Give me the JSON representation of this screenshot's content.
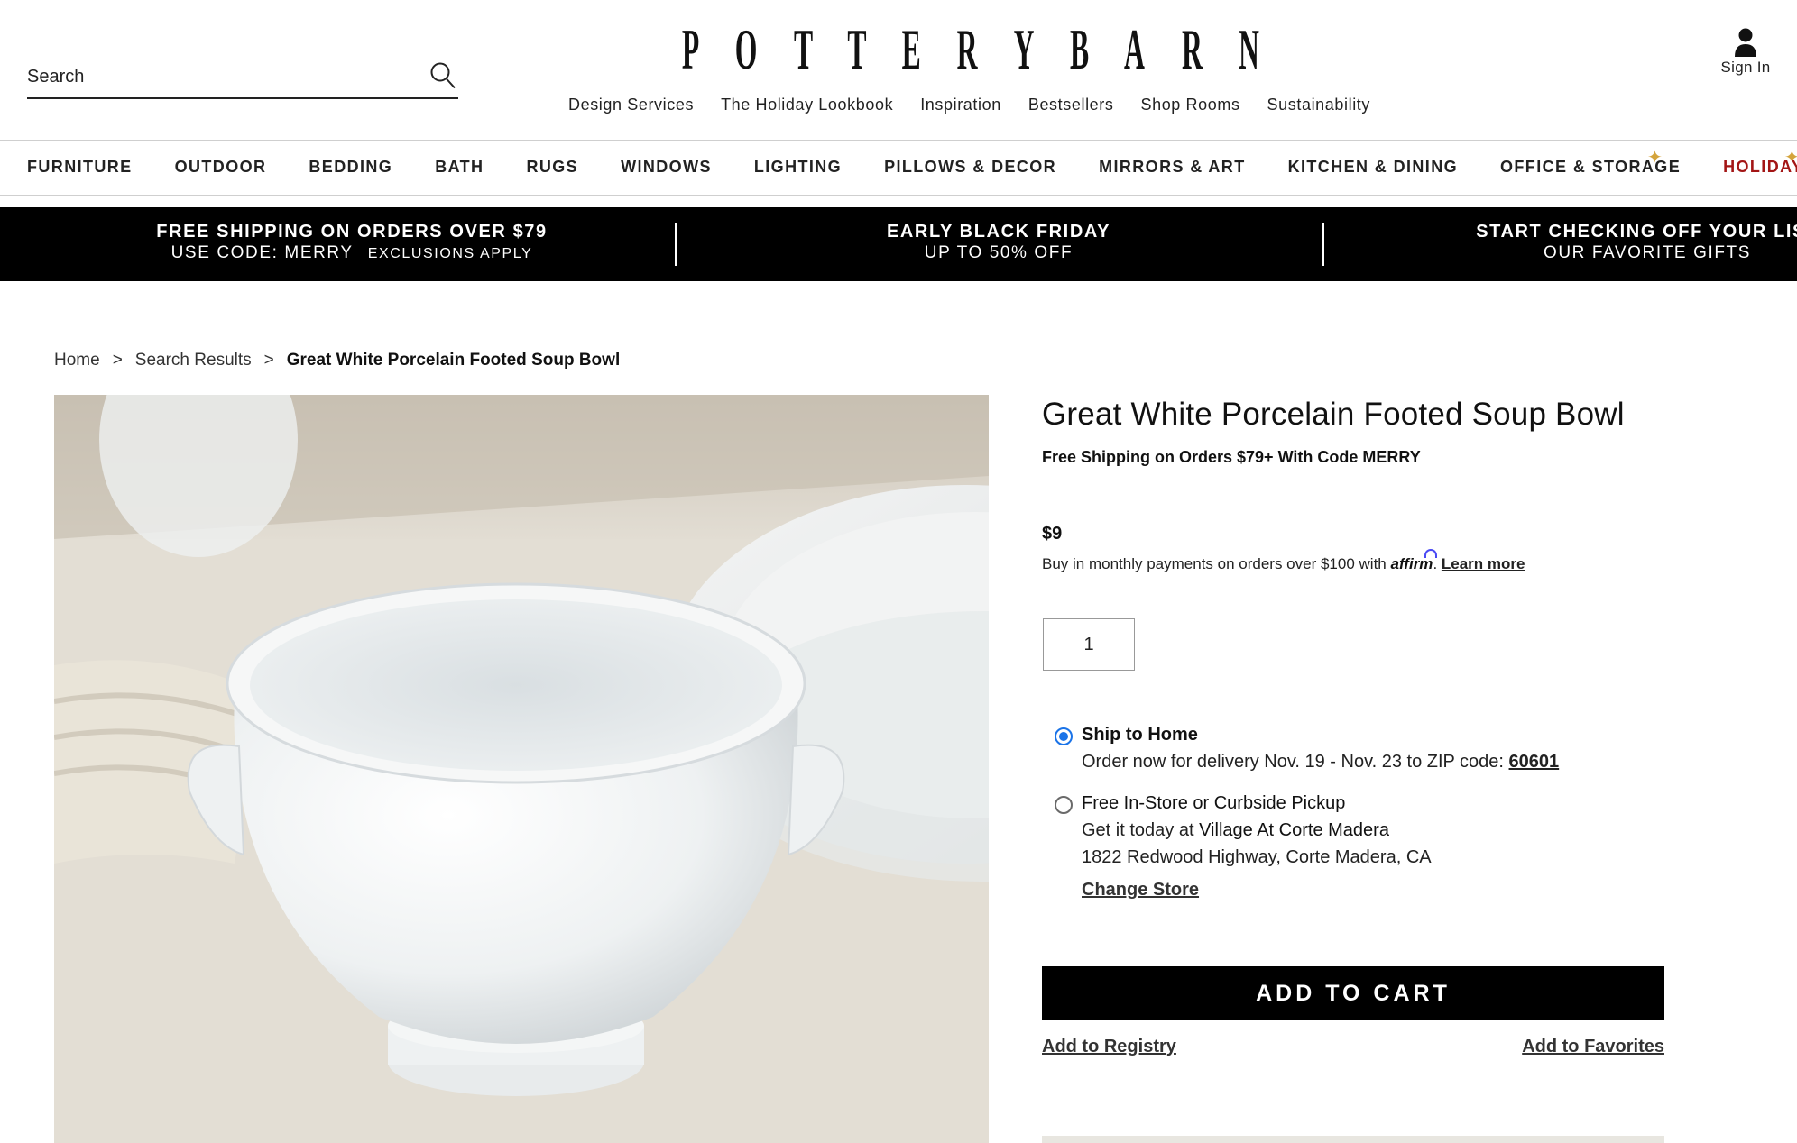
{
  "header": {
    "search_placeholder": "Search",
    "logo_letters": [
      "P",
      "O",
      "T",
      "T",
      "E",
      "R",
      "Y",
      "B",
      "A",
      "R",
      "N"
    ],
    "logo_text": "POTTERY BARN",
    "top_links": [
      "Design Services",
      "The Holiday Lookbook",
      "Inspiration",
      "Bestsellers",
      "Shop Rooms",
      "Sustainability"
    ],
    "signin_label": "Sign In"
  },
  "categories": [
    "FURNITURE",
    "OUTDOOR",
    "BEDDING",
    "BATH",
    "RUGS",
    "WINDOWS",
    "LIGHTING",
    "PILLOWS & DECOR",
    "MIRRORS & ART",
    "KITCHEN & DINING",
    "OFFICE & STORAGE",
    "HOLIDAYS"
  ],
  "promos": [
    {
      "line1": "FREE SHIPPING ON ORDERS OVER $79",
      "line2": "USE CODE: MERRY",
      "line2_small": "EXCLUSIONS APPLY"
    },
    {
      "line1": "EARLY BLACK FRIDAY",
      "line2": "UP TO 50% OFF"
    },
    {
      "line1": "START CHECKING OFF YOUR LIST",
      "line2": "OUR FAVORITE GIFTS"
    }
  ],
  "breadcrumb": {
    "home": "Home",
    "search_results": "Search Results",
    "current": "Great White Porcelain Footed Soup Bowl",
    "separator": ">"
  },
  "product": {
    "title": "Great White Porcelain Footed Soup Bowl",
    "free_shipping": "Free Shipping on Orders $79+ With Code MERRY",
    "price": "$9",
    "affirm_text": "Buy in monthly payments on orders over $100 with",
    "affirm_logo": "affirm",
    "learn_more": "Learn more",
    "quantity": "1"
  },
  "shipping": {
    "ship_home_title": "Ship to Home",
    "ship_home_text": "Order now for delivery Nov. 19 - Nov. 23 to ZIP code:",
    "zip": "60601",
    "pickup_title": "Free In-Store or Curbside Pickup",
    "pickup_text": "Get it today at",
    "store_name": "Village At Corte Madera",
    "store_address": "1822 Redwood Highway, Corte Madera, CA",
    "change_store": "Change Store"
  },
  "actions": {
    "add_to_cart": "ADD TO CART",
    "add_to_registry": "Add to Registry",
    "add_to_favorites": "Add to Favorites"
  },
  "colors": {
    "accent_holiday": "#a31515",
    "radio_selected": "#1a73e8",
    "promo_bg": "#000000",
    "affirm": "#4a4af4"
  },
  "icons": {
    "search": "magnifier-icon",
    "user": "user-icon",
    "sparkle": "sparkle-icon"
  }
}
